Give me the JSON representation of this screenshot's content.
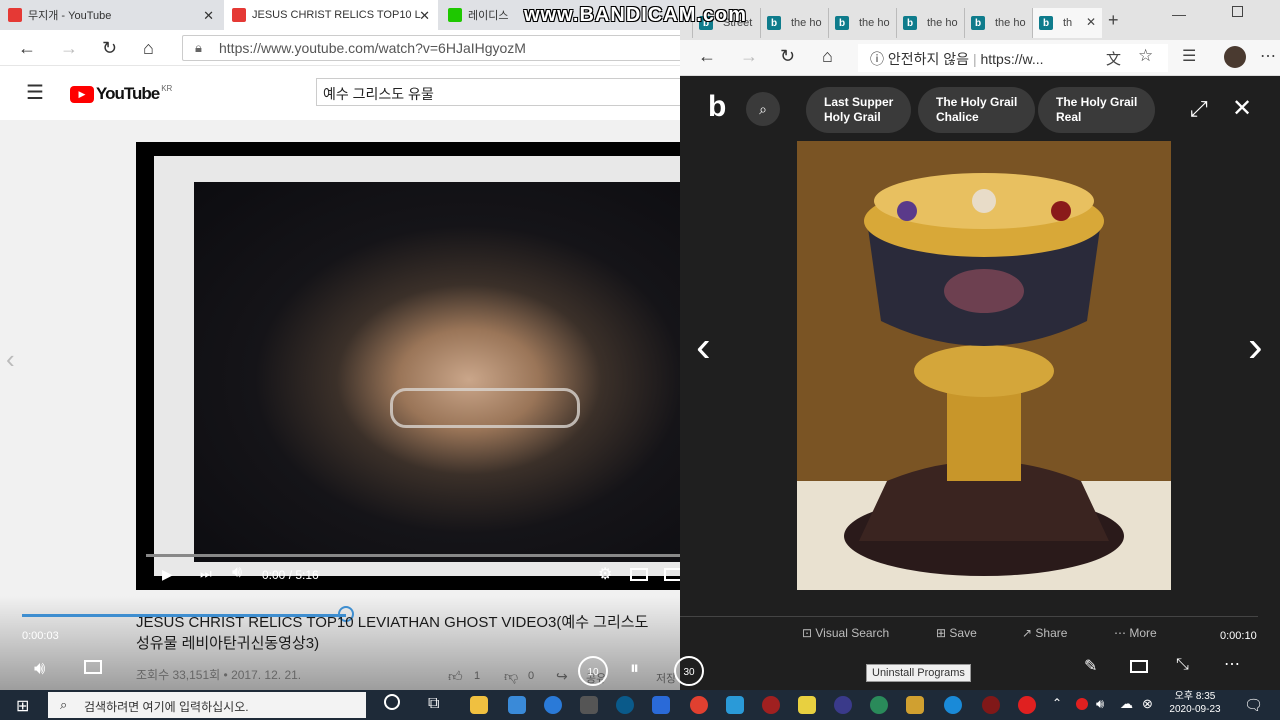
{
  "left_browser": {
    "tabs": [
      {
        "label": "무지개 - YouTube",
        "active": false
      },
      {
        "label": "JESUS CHRIST RELICS TOP10 L",
        "active": true
      },
      {
        "label": "레이디스",
        "active": false
      }
    ],
    "url": "https://www.youtube.com/watch?v=6HJaIHgyozM",
    "youtube": {
      "logo_text": "YouTube",
      "region": "KR",
      "search_value": "예수 그리스도 유물"
    },
    "player": {
      "time": "0:00 / 5:16",
      "elapsed_overlay": "0:00:03",
      "progress": 0.0
    },
    "video_title_line1": "JESUS CHRIST RELICS TOP10 LEVIATHAN GHOST VIDEO3(예수 그리스도",
    "video_title_line2": "성유물 레비아탄귀신동영상3)",
    "meta": "조회수 33,151회 • 2017. 12. 21.",
    "likes": "1",
    "dislikes": "0",
    "share_label": "공유",
    "save_label": "저장"
  },
  "right_browser": {
    "tabs": [
      {
        "label": "Street"
      },
      {
        "label": "the ho"
      },
      {
        "label": "the ho"
      },
      {
        "label": "the ho"
      },
      {
        "label": "the ho"
      },
      {
        "label": "th"
      }
    ],
    "security_label": "안전하지 않음",
    "url": "https://w...",
    "bing_pills": [
      {
        "line1": "Last Supper",
        "line2": "Holy Grail"
      },
      {
        "line1": "The Holy Grail",
        "line2": "Chalice"
      },
      {
        "line1": "The Holy Grail",
        "line2": "Real"
      }
    ],
    "actions": {
      "visual_search": "Visual Search",
      "save": "Save",
      "share": "Share",
      "more": "More"
    },
    "timestamp_overlay": "0:00:10"
  },
  "overlays": {
    "watermark": "www.BANDICAM.com",
    "rewind_label": "10",
    "forward_label": "30",
    "tooltip": "Uninstall Programs"
  },
  "taskbar": {
    "search_placeholder": "검색하려면 여기에 입력하십시오.",
    "time": "오후 8:35",
    "date": "2020-09-23"
  }
}
